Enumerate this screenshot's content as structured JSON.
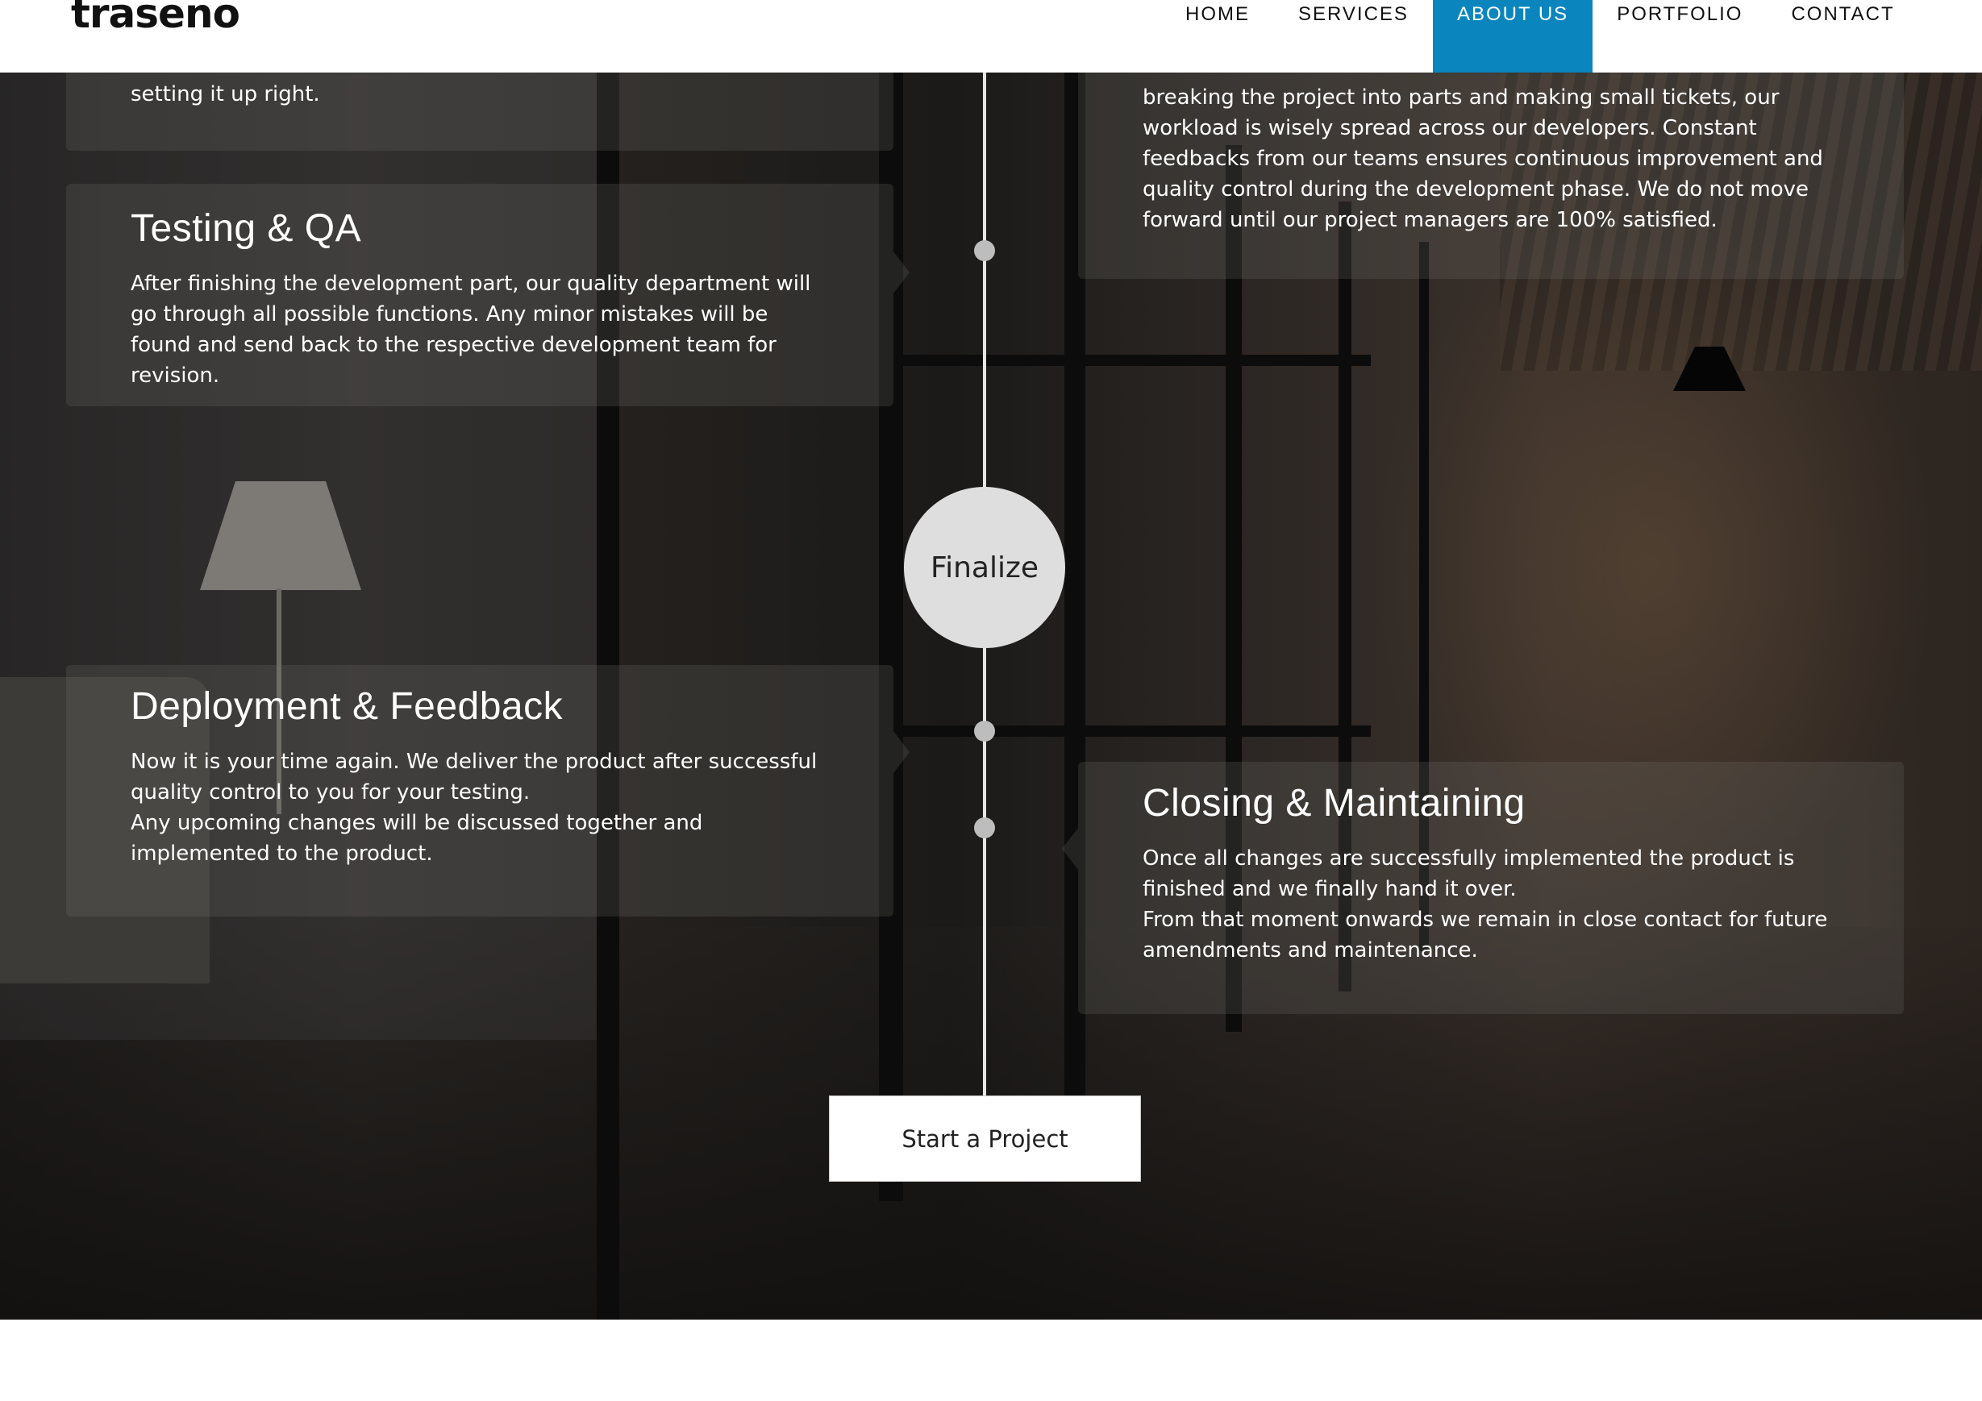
{
  "brand": {
    "logo_text": "traseno"
  },
  "nav": {
    "items": [
      {
        "label": "HOME",
        "active": false
      },
      {
        "label": "SERVICES",
        "active": false
      },
      {
        "label": "ABOUT US",
        "active": true
      },
      {
        "label": "PORTFOLIO",
        "active": false
      },
      {
        "label": "CONTACT",
        "active": false
      }
    ],
    "active_color": "#0b85bd"
  },
  "timeline": {
    "partial_left_text": "setting it up right.",
    "partial_right_text": "breaking the project into parts and making small tickets, our workload is wisely spread across our developers. Constant feedbacks from our teams ensures continuous improvement and quality control during the development phase. We do not move forward until our project managers are 100% satisfied.",
    "steps": [
      {
        "title": "Testing & QA",
        "body": "After finishing the development part, our quality department will go through all possible functions. Any minor mistakes will be found and send back to the respective development team for revision."
      },
      {
        "title": "Deployment & Feedback",
        "body_lines": [
          "Now it is your time again. We deliver the product after successful quality control to you for your testing.",
          "Any upcoming changes will be discussed together and implemented to the product."
        ]
      },
      {
        "title": "Closing & Maintaining",
        "body_lines": [
          "Once all changes are successfully implemented the product is finished and we finally hand it over.",
          "From that moment onwards we remain in close contact for future amendments and maintenance."
        ]
      }
    ],
    "milestone_label": "Finalize"
  },
  "cta": {
    "label": "Start a Project"
  }
}
